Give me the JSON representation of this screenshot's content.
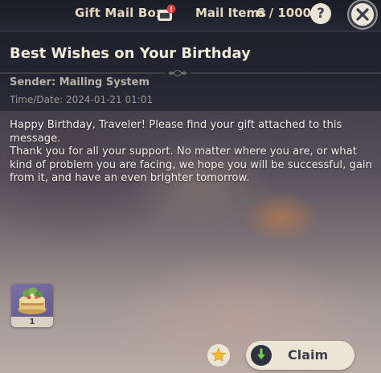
{
  "top_bar": {
    "title": "Gift Mail Box",
    "notification_badge": "!",
    "mail_items_label": "Mail Items",
    "mail_count": "6 / 1000",
    "help_label": "?"
  },
  "mail": {
    "title": "Best Wishes on Your Birthday",
    "sender": "Sender: Mailing System",
    "date": "Time/Date: 2024-01-21 01:01",
    "body": [
      "Happy Birthday, Traveler! Please find your gift attached to this message.",
      "Thank you for all your support. No matter where you are, or what kind of problem you are facing, we hope you will be successful, gain from it, and have an even brighter tomorrow."
    ]
  },
  "attachment": {
    "icon": "birthday-cake-icon",
    "count": "1"
  },
  "actions": {
    "star_icon": "star-icon",
    "claim_icon": "download-arrow-icon",
    "claim_label": "Claim"
  },
  "colors": {
    "text_gold": "#e7d9bf",
    "button_bg": "#ece5d6",
    "claim_icon_green": "#6fcf4f",
    "star_gold": "#f2b93b",
    "attachment_purple": "#6e659a"
  }
}
